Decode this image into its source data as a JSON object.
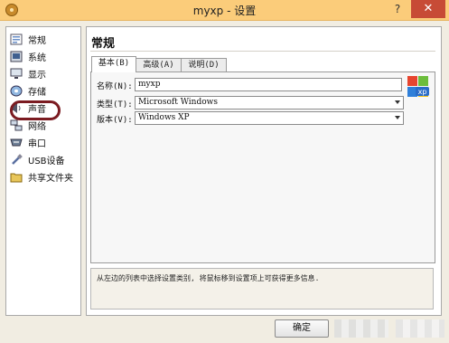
{
  "window": {
    "title": "myxp - 设置",
    "help_label": "?",
    "close_label": "✕"
  },
  "sidebar": {
    "items": [
      {
        "label": "常规",
        "icon": "general-icon"
      },
      {
        "label": "系统",
        "icon": "system-icon"
      },
      {
        "label": "显示",
        "icon": "display-icon"
      },
      {
        "label": "存储",
        "icon": "storage-icon"
      },
      {
        "label": "声音",
        "icon": "audio-icon"
      },
      {
        "label": "网络",
        "icon": "network-icon"
      },
      {
        "label": "串口",
        "icon": "serial-port-icon"
      },
      {
        "label": "USB设备",
        "icon": "usb-icon"
      },
      {
        "label": "共享文件夹",
        "icon": "shared-folder-icon"
      }
    ],
    "highlighted_item": "存储",
    "highlight_color": "#7b1b21"
  },
  "panel": {
    "title": "常规",
    "tabs": [
      {
        "label": "基本(B)",
        "active": true
      },
      {
        "label": "高级(A)",
        "active": false
      },
      {
        "label": "说明(D)",
        "active": false
      }
    ],
    "form": {
      "name_label": "名称(N):",
      "name_value": "myxp",
      "type_label": "类型(T):",
      "type_value": "Microsoft Windows",
      "version_label": "版本(V):",
      "version_value": "Windows XP"
    },
    "os_logo_text": "xp",
    "info_text": "从左边的列表中选择设置类别, 将鼠标移到设置项上可获得更多信息."
  },
  "buttons": {
    "ok_label": "确定"
  },
  "colors": {
    "titlebar": "#fbcc7a",
    "close_button": "#c74b36",
    "highlight": "#7b1b21"
  }
}
